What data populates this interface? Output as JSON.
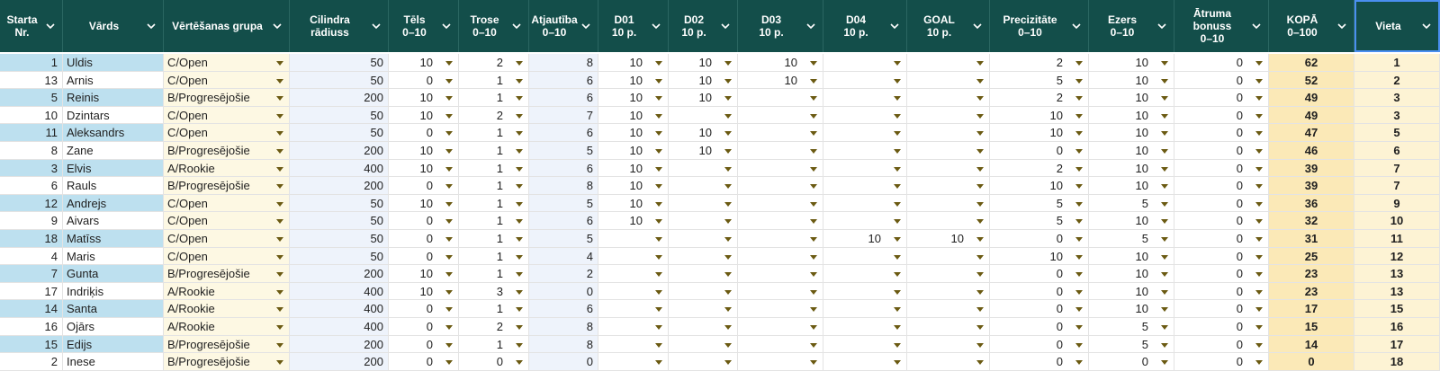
{
  "headers": [
    {
      "key": "nr",
      "label": "Starta\nNr."
    },
    {
      "key": "name",
      "label": "Vārds"
    },
    {
      "key": "group",
      "label": "Vērtēšanas grupa"
    },
    {
      "key": "radius",
      "label": "Cilindra\nrādiuss"
    },
    {
      "key": "tels",
      "label": "Tēls\n0–10"
    },
    {
      "key": "trose",
      "label": "Trose\n0–10"
    },
    {
      "key": "atj",
      "label": "Atjautība\n0–10"
    },
    {
      "key": "d01",
      "label": "D01\n10 p."
    },
    {
      "key": "d02",
      "label": "D02\n10 p."
    },
    {
      "key": "d03",
      "label": "D03\n10 p."
    },
    {
      "key": "d04",
      "label": "D04\n10 p."
    },
    {
      "key": "goal",
      "label": "GOAL\n10 p."
    },
    {
      "key": "prec",
      "label": "Precizitāte\n0–10"
    },
    {
      "key": "ezers",
      "label": "Ezers\n0–10"
    },
    {
      "key": "bonus",
      "label": "Ātruma\nbonuss\n0–10"
    },
    {
      "key": "kopa",
      "label": "KOPĀ\n0–100"
    },
    {
      "key": "vieta",
      "label": "Vieta"
    }
  ],
  "rows": [
    {
      "nr": "1",
      "name": "Uldis",
      "group": "C/Open",
      "radius": "50",
      "tels": "10",
      "trose": "2",
      "atj": "8",
      "d01": "10",
      "d02": "10",
      "d03": "10",
      "d04": "",
      "goal": "",
      "prec": "2",
      "ezers": "10",
      "bonus": "0",
      "kopa": "62",
      "vieta": "1"
    },
    {
      "nr": "13",
      "name": "Arnis",
      "group": "C/Open",
      "radius": "50",
      "tels": "0",
      "trose": "1",
      "atj": "6",
      "d01": "10",
      "d02": "10",
      "d03": "10",
      "d04": "",
      "goal": "",
      "prec": "5",
      "ezers": "10",
      "bonus": "0",
      "kopa": "52",
      "vieta": "2"
    },
    {
      "nr": "5",
      "name": "Reinis",
      "group": "B/Progresējošie",
      "radius": "200",
      "tels": "10",
      "trose": "1",
      "atj": "6",
      "d01": "10",
      "d02": "10",
      "d03": "",
      "d04": "",
      "goal": "",
      "prec": "2",
      "ezers": "10",
      "bonus": "0",
      "kopa": "49",
      "vieta": "3"
    },
    {
      "nr": "10",
      "name": "Dzintars",
      "group": "C/Open",
      "radius": "50",
      "tels": "10",
      "trose": "2",
      "atj": "7",
      "d01": "10",
      "d02": "",
      "d03": "",
      "d04": "",
      "goal": "",
      "prec": "10",
      "ezers": "10",
      "bonus": "0",
      "kopa": "49",
      "vieta": "3"
    },
    {
      "nr": "11",
      "name": "Aleksandrs",
      "group": "C/Open",
      "radius": "50",
      "tels": "0",
      "trose": "1",
      "atj": "6",
      "d01": "10",
      "d02": "10",
      "d03": "",
      "d04": "",
      "goal": "",
      "prec": "10",
      "ezers": "10",
      "bonus": "0",
      "kopa": "47",
      "vieta": "5"
    },
    {
      "nr": "8",
      "name": "Zane",
      "group": "B/Progresējošie",
      "radius": "200",
      "tels": "10",
      "trose": "1",
      "atj": "5",
      "d01": "10",
      "d02": "10",
      "d03": "",
      "d04": "",
      "goal": "",
      "prec": "0",
      "ezers": "10",
      "bonus": "0",
      "kopa": "46",
      "vieta": "6"
    },
    {
      "nr": "3",
      "name": "Elvis",
      "group": "A/Rookie",
      "radius": "400",
      "tels": "10",
      "trose": "1",
      "atj": "6",
      "d01": "10",
      "d02": "",
      "d03": "",
      "d04": "",
      "goal": "",
      "prec": "2",
      "ezers": "10",
      "bonus": "0",
      "kopa": "39",
      "vieta": "7"
    },
    {
      "nr": "6",
      "name": "Rauls",
      "group": "B/Progresējošie",
      "radius": "200",
      "tels": "0",
      "trose": "1",
      "atj": "8",
      "d01": "10",
      "d02": "",
      "d03": "",
      "d04": "",
      "goal": "",
      "prec": "10",
      "ezers": "10",
      "bonus": "0",
      "kopa": "39",
      "vieta": "7"
    },
    {
      "nr": "12",
      "name": "Andrejs",
      "group": "C/Open",
      "radius": "50",
      "tels": "10",
      "trose": "1",
      "atj": "5",
      "d01": "10",
      "d02": "",
      "d03": "",
      "d04": "",
      "goal": "",
      "prec": "5",
      "ezers": "5",
      "bonus": "0",
      "kopa": "36",
      "vieta": "9"
    },
    {
      "nr": "9",
      "name": "Aivars",
      "group": "C/Open",
      "radius": "50",
      "tels": "0",
      "trose": "1",
      "atj": "6",
      "d01": "10",
      "d02": "",
      "d03": "",
      "d04": "",
      "goal": "",
      "prec": "5",
      "ezers": "10",
      "bonus": "0",
      "kopa": "32",
      "vieta": "10"
    },
    {
      "nr": "18",
      "name": "Matīss",
      "group": "C/Open",
      "radius": "50",
      "tels": "0",
      "trose": "1",
      "atj": "5",
      "d01": "",
      "d02": "",
      "d03": "",
      "d04": "10",
      "goal": "10",
      "prec": "0",
      "ezers": "5",
      "bonus": "0",
      "kopa": "31",
      "vieta": "11"
    },
    {
      "nr": "4",
      "name": "Maris",
      "group": "C/Open",
      "radius": "50",
      "tels": "0",
      "trose": "1",
      "atj": "4",
      "d01": "",
      "d02": "",
      "d03": "",
      "d04": "",
      "goal": "",
      "prec": "10",
      "ezers": "10",
      "bonus": "0",
      "kopa": "25",
      "vieta": "12"
    },
    {
      "nr": "7",
      "name": "Gunta",
      "group": "B/Progresējošie",
      "radius": "200",
      "tels": "10",
      "trose": "1",
      "atj": "2",
      "d01": "",
      "d02": "",
      "d03": "",
      "d04": "",
      "goal": "",
      "prec": "0",
      "ezers": "10",
      "bonus": "0",
      "kopa": "23",
      "vieta": "13"
    },
    {
      "nr": "17",
      "name": "Indriķis",
      "group": "A/Rookie",
      "radius": "400",
      "tels": "10",
      "trose": "3",
      "atj": "0",
      "d01": "",
      "d02": "",
      "d03": "",
      "d04": "",
      "goal": "",
      "prec": "0",
      "ezers": "10",
      "bonus": "0",
      "kopa": "23",
      "vieta": "13"
    },
    {
      "nr": "14",
      "name": "Santa",
      "group": "A/Rookie",
      "radius": "400",
      "tels": "0",
      "trose": "1",
      "atj": "6",
      "d01": "",
      "d02": "",
      "d03": "",
      "d04": "",
      "goal": "",
      "prec": "0",
      "ezers": "10",
      "bonus": "0",
      "kopa": "17",
      "vieta": "15"
    },
    {
      "nr": "16",
      "name": "Ojārs",
      "group": "A/Rookie",
      "radius": "400",
      "tels": "0",
      "trose": "2",
      "atj": "8",
      "d01": "",
      "d02": "",
      "d03": "",
      "d04": "",
      "goal": "",
      "prec": "0",
      "ezers": "5",
      "bonus": "0",
      "kopa": "15",
      "vieta": "16"
    },
    {
      "nr": "15",
      "name": "Edijs",
      "group": "B/Progresējošie",
      "radius": "200",
      "tels": "0",
      "trose": "1",
      "atj": "8",
      "d01": "",
      "d02": "",
      "d03": "",
      "d04": "",
      "goal": "",
      "prec": "0",
      "ezers": "5",
      "bonus": "0",
      "kopa": "14",
      "vieta": "17"
    },
    {
      "nr": "2",
      "name": "Inese",
      "group": "B/Progresējošie",
      "radius": "200",
      "tels": "0",
      "trose": "0",
      "atj": "0",
      "d01": "",
      "d02": "",
      "d03": "",
      "d04": "",
      "goal": "",
      "prec": "0",
      "ezers": "0",
      "bonus": "0",
      "kopa": "0",
      "vieta": "18"
    }
  ],
  "icons": {
    "header_filter": "chevron-down-icon",
    "cell_dropdown": "dropdown-arrow-icon"
  },
  "colors": {
    "header_bg": "#134e4a",
    "header_text": "#ffffff",
    "id_band": "#bde0ef",
    "group_bg": "#fdf8e3",
    "radius_bg": "#eef3fb",
    "atj_bg": "#eef3fb",
    "total_bg": "#fbe9b7",
    "rank_bg": "#fdf3d4",
    "dropdown_arrow": "#6b5a12",
    "selection": "#4a8ff0"
  }
}
